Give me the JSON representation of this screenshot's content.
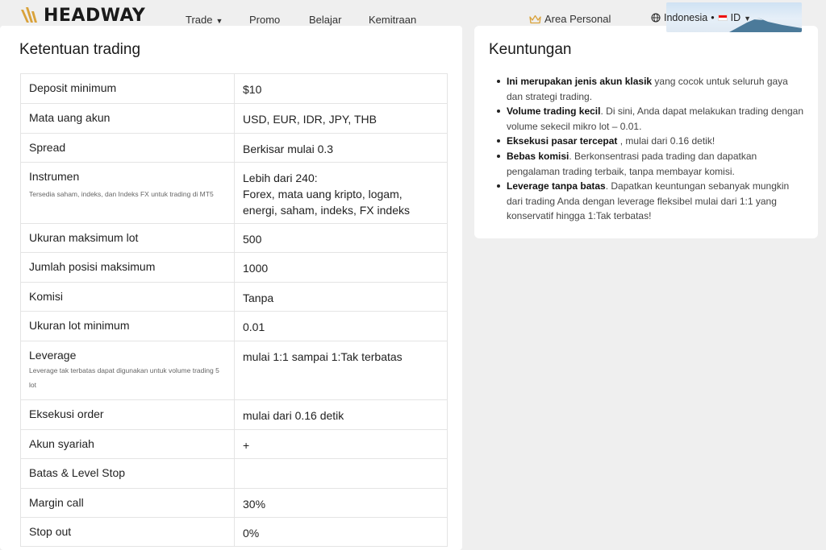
{
  "header": {
    "logo_text": "HEADWAY",
    "nav": [
      {
        "label": "Trade",
        "has_dropdown": true
      },
      {
        "label": "Promo"
      },
      {
        "label": "Belajar"
      },
      {
        "label": "Kemitraan"
      }
    ],
    "area_personal": "Area Personal",
    "language": "Indonesia",
    "separator": "•",
    "lang_code": "ID"
  },
  "left": {
    "title": "Ketentuan trading",
    "rows": [
      {
        "key": "Deposit minimum",
        "value": "$10"
      },
      {
        "key": "Mata uang akun",
        "value": "USD, EUR, IDR, JPY, THB"
      },
      {
        "key": "Spread",
        "value": "Berkisar mulai 0.3"
      },
      {
        "key": "Instrumen",
        "note": "Tersedia saham, indeks, dan Indeks FX untuk trading di MT5",
        "value": "Lebih dari 240:",
        "value2": "Forex, mata uang kripto, logam, energi, saham, indeks, FX indeks"
      },
      {
        "key": "Ukuran maksimum lot",
        "value": "500"
      },
      {
        "key": "Jumlah posisi maksimum",
        "value": "1000"
      },
      {
        "key": "Komisi",
        "value": "Tanpa"
      },
      {
        "key": "Ukuran lot minimum",
        "value": "0.01"
      },
      {
        "key": "Leverage",
        "note": "Leverage tak terbatas dapat digunakan untuk volume trading 5 lot",
        "value": "mulai 1:1 sampai 1:Tak terbatas"
      },
      {
        "key": "Eksekusi order",
        "value": "mulai dari 0.16 detik"
      },
      {
        "key": "Akun syariah",
        "value": "+"
      },
      {
        "key": "Batas & Level Stop",
        "value": ""
      },
      {
        "key": "Margin call",
        "value": "30%"
      },
      {
        "key": "Stop out",
        "value": "0%"
      }
    ]
  },
  "right": {
    "title": "Keuntungan",
    "items": [
      {
        "bold": "Ini merupakan jenis akun klasik",
        "text": " yang cocok untuk seluruh gaya dan strategi trading."
      },
      {
        "bold": "Volume trading kecil",
        "text": ". Di sini, Anda dapat melakukan trading dengan volume sekecil mikro lot – 0.01."
      },
      {
        "bold": "Eksekusi pasar tercepat",
        "text": " , mulai dari 0.16 detik!"
      },
      {
        "bold": "Bebas komisi",
        "text": ". Berkonsentrasi pada trading dan dapatkan pengalaman trading terbaik, tanpa membayar komisi."
      },
      {
        "bold": "Leverage tanpa batas",
        "text": ". Dapatkan keuntungan sebanyak mungkin dari trading Anda dengan leverage fleksibel mulai dari 1:1 yang konservatif hingga 1:Tak terbatas!"
      }
    ]
  },
  "colors": {
    "accent": "#d9a23b",
    "card": "#ffffff",
    "background": "#efefef"
  }
}
